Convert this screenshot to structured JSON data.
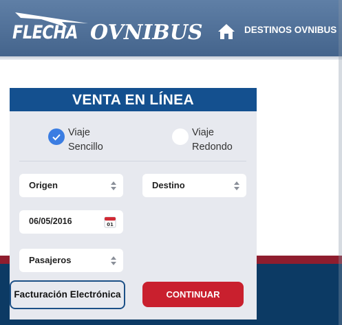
{
  "header": {
    "logo_flecha": "FLECHA",
    "logo_ovnibus": "OVNIBUS",
    "nav_destinos": "DESTINOS OVNIBUS"
  },
  "form": {
    "title": "VENTA EN LÍNEA",
    "trip_type": {
      "one_way_label_1": "Viaje",
      "one_way_label_2": "Sencillo",
      "one_way_checked": true,
      "round_label_1": "Viaje",
      "round_label_2": "Redondo",
      "round_checked": false
    },
    "origin": "Origen",
    "destination": "Destino",
    "date": "06/05/2016",
    "calendar_day": "01",
    "passengers": "Pasajeros",
    "invoice_button": "Facturación Electrónica",
    "continue_button": "CONTINUAR"
  },
  "colors": {
    "header": "#4f6f97",
    "title_bar": "#14508f",
    "radio_checked": "#3b7de2",
    "continue": "#c9202e",
    "footer_red": "#8f1d2e",
    "footer_blue": "#0c3a64"
  }
}
